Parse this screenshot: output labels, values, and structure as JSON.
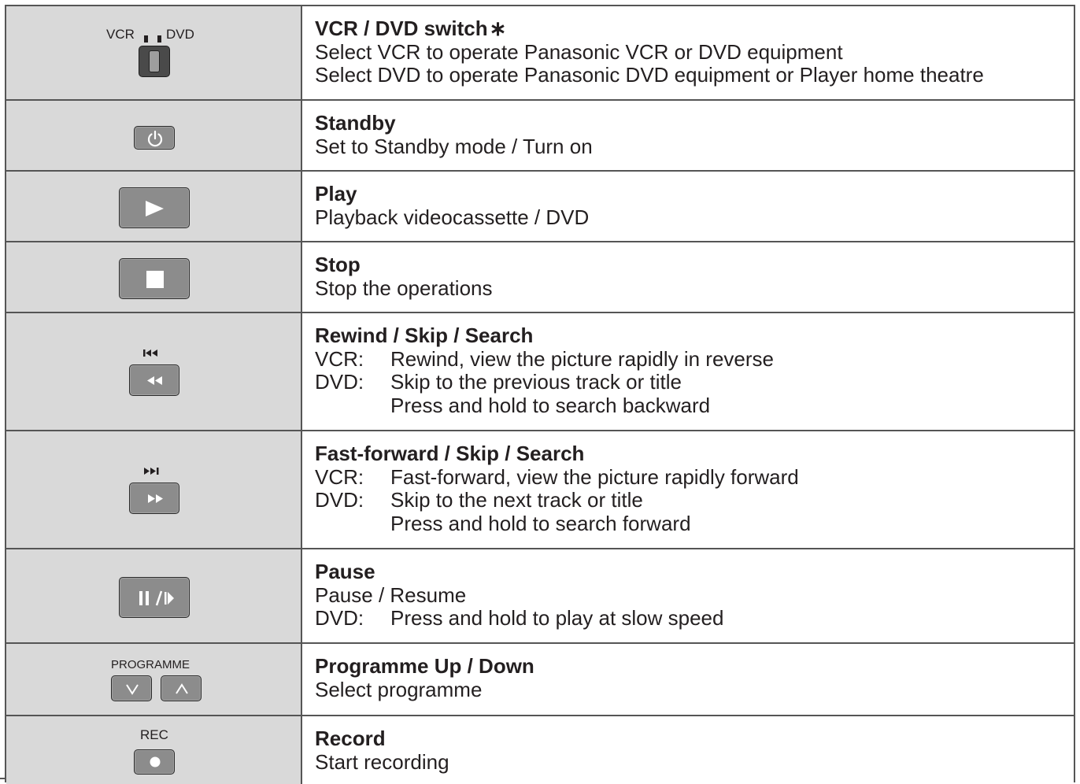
{
  "rows": [
    {
      "title": "VCR / DVD switch",
      "asterisk": "∗",
      "lines": [
        "Select VCR to operate Panasonic VCR or DVD equipment",
        "Select DVD to operate Panasonic DVD equipment or Player home theatre"
      ],
      "switch": {
        "left_label": "VCR",
        "right_label": "DVD"
      }
    },
    {
      "title": "Standby",
      "lines": [
        "Set to Standby mode / Turn on"
      ]
    },
    {
      "title": "Play",
      "lines": [
        "Playback videocassette / DVD"
      ]
    },
    {
      "title": "Stop",
      "lines": [
        "Stop the operations"
      ]
    },
    {
      "title": "Rewind / Skip / Search",
      "vcr_prefix": "VCR:",
      "vcr_text": "Rewind, view the picture rapidly in reverse",
      "dvd_prefix": "DVD:",
      "dvd_text": "Skip to the previous track or title",
      "dvd_text2": "Press and hold to search backward"
    },
    {
      "title": "Fast-forward / Skip / Search",
      "vcr_prefix": "VCR:",
      "vcr_text": "Fast-forward, view the picture rapidly forward",
      "dvd_prefix": "DVD:",
      "dvd_text": "Skip to the next track or title",
      "dvd_text2": "Press and hold to search forward"
    },
    {
      "title": "Pause",
      "lines": [
        "Pause / Resume"
      ],
      "dvd_prefix": "DVD:",
      "dvd_text": "Press and hold to play at slow speed"
    },
    {
      "title": "Programme Up / Down",
      "lines": [
        "Select programme"
      ],
      "caption": "PROGRAMME"
    },
    {
      "title": "Record",
      "lines": [
        "Start recording"
      ],
      "caption": "REC"
    }
  ],
  "icons": {
    "switch": "switch-icon",
    "standby": "power-icon",
    "play": "play-icon",
    "stop": "stop-icon",
    "rewind": "rewind-icon",
    "skip_previous": "skip-previous-icon",
    "fast_forward": "fast-forward-icon",
    "skip_next": "skip-next-icon",
    "pause": "pause-slow-icon",
    "down": "chevron-down-icon",
    "up": "chevron-up-icon",
    "record": "record-icon"
  },
  "colors": {
    "icon_cell_background": "#d9d9d9",
    "button_fill": "#8c8c8c",
    "rule": "#555555"
  }
}
